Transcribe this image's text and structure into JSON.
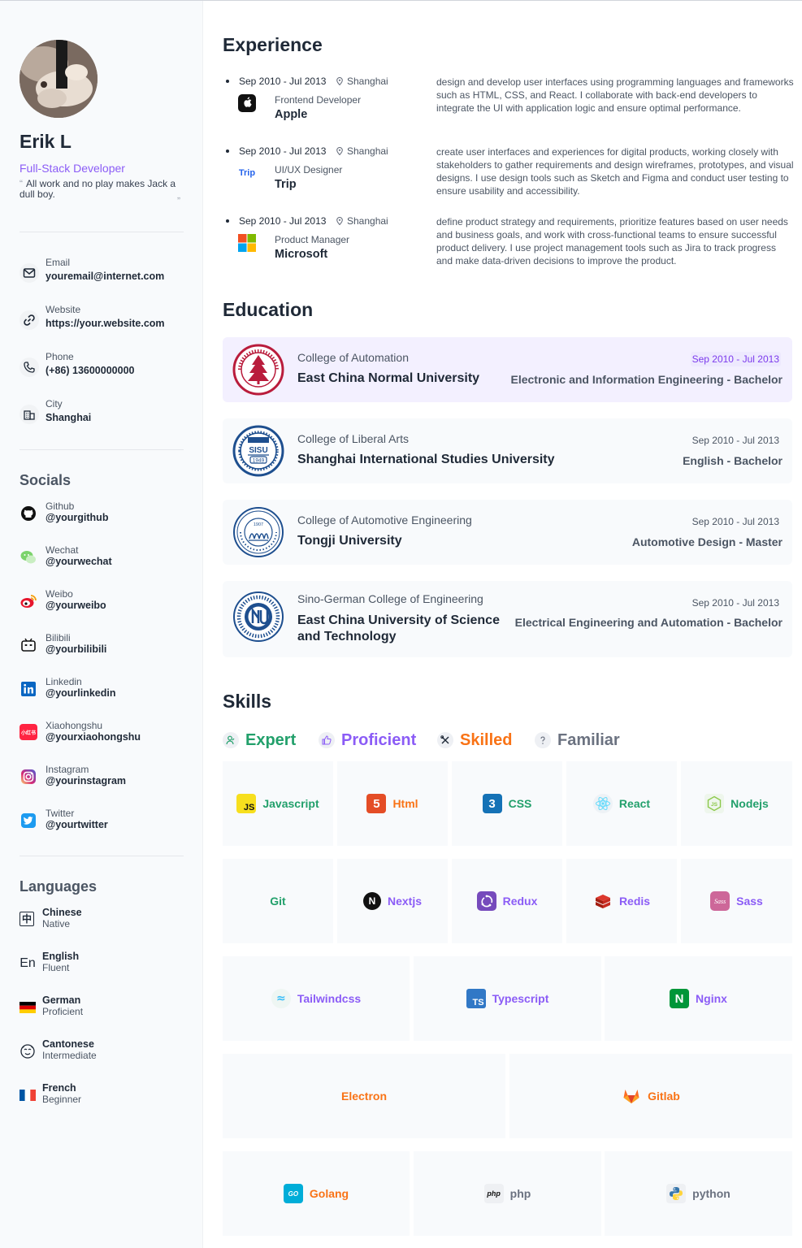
{
  "profile": {
    "name": "Erik L",
    "role": "Full-Stack Developer",
    "quote": "All work and no play makes Jack a dull boy."
  },
  "contacts": [
    {
      "label": "Email",
      "value": "youremail@internet.com",
      "icon": "mail-icon"
    },
    {
      "label": "Website",
      "value": "https://your.website.com",
      "icon": "link-icon"
    },
    {
      "label": "Phone",
      "value": "(+86) 13600000000",
      "icon": "phone-icon"
    },
    {
      "label": "City",
      "value": "Shanghai",
      "icon": "city-icon"
    }
  ],
  "socials": {
    "title": "Socials",
    "items": [
      {
        "label": "Github",
        "value": "@yourgithub",
        "icon": "github-icon"
      },
      {
        "label": "Wechat",
        "value": "@yourwechat",
        "icon": "wechat-icon"
      },
      {
        "label": "Weibo",
        "value": "@yourweibo",
        "icon": "weibo-icon"
      },
      {
        "label": "Bilibili",
        "value": "@yourbilibili",
        "icon": "bilibili-icon"
      },
      {
        "label": "Linkedin",
        "value": "@yourlinkedin",
        "icon": "linkedin-icon"
      },
      {
        "label": "Xiaohongshu",
        "value": "@yourxiaohongshu",
        "icon": "xiaohongshu-icon",
        "glyph": "小红书"
      },
      {
        "label": "Instagram",
        "value": "@yourinstagram",
        "icon": "instagram-icon"
      },
      {
        "label": "Twitter",
        "value": "@yourtwitter",
        "icon": "twitter-icon"
      }
    ]
  },
  "languages": {
    "title": "Languages",
    "items": [
      {
        "label": "Chinese",
        "value": "Native",
        "icon": "chinese-char-icon",
        "glyph": "中"
      },
      {
        "label": "English",
        "value": "Fluent",
        "icon": "english-icon",
        "glyph": "En"
      },
      {
        "label": "German",
        "value": "Proficient",
        "icon": "german-flag-icon"
      },
      {
        "label": "Cantonese",
        "value": "Intermediate",
        "icon": "cantonese-icon"
      },
      {
        "label": "French",
        "value": "Beginner",
        "icon": "french-flag-icon"
      }
    ]
  },
  "experience": {
    "title": "Experience",
    "items": [
      {
        "date": "Sep 2010 - Jul 2013",
        "location": "Shanghai",
        "title": "Frontend Developer",
        "company": "Apple",
        "logo": "apple-logo-icon",
        "desc": "design and develop user interfaces using programming languages and frameworks such as HTML, CSS, and React. I collaborate with back-end developers to integrate the UI with application logic and ensure optimal performance."
      },
      {
        "date": "Sep 2010 - Jul 2013",
        "location": "Shanghai",
        "title": "UI/UX Designer",
        "company": "Trip",
        "logo": "trip-logo-icon",
        "logo_text": "Trip",
        "desc": "create user interfaces and experiences for digital products, working closely with stakeholders to gather requirements and design wireframes, prototypes, and visual designs. I use design tools such as Sketch and Figma and conduct user testing to ensure usability and accessibility."
      },
      {
        "date": "Sep 2010 - Jul 2013",
        "location": "Shanghai",
        "title": "Product Manager",
        "company": "Microsoft",
        "logo": "microsoft-logo-icon",
        "desc": "define product strategy and requirements, prioritize features based on user needs and business goals, and work with cross-functional teams to ensure successful product delivery. I use project management tools such as Jira to track progress and make data-driven decisions to improve the product."
      }
    ]
  },
  "education": {
    "title": "Education",
    "items": [
      {
        "college": "College of Automation",
        "university": "East China Normal University",
        "date": "Sep 2010 - Jul 2013",
        "major": "Electronic and Information Engineering - Bachelor",
        "seal": "ecnu-seal-icon",
        "color": "#b91c3c"
      },
      {
        "college": "College of Liberal Arts",
        "university": "Shanghai International Studies University",
        "date": "Sep 2010 - Jul 2013",
        "major": "English - Bachelor",
        "seal": "sisu-seal-icon",
        "color": "#1e4f8f",
        "seal_text": "SISU",
        "seal_year": "1949"
      },
      {
        "college": "College of Automotive Engineering",
        "university": "Tongji University",
        "date": "Sep 2010 - Jul 2013",
        "major": "Automotive Design - Master",
        "seal": "tongji-seal-icon",
        "color": "#1e4f8f",
        "seal_year": "1907"
      },
      {
        "college": "Sino-German College of Engineering",
        "university": "East China University of Science and Technology",
        "date": "Sep 2010 - Jul 2013",
        "major": "Electrical Engineering and Automation - Bachelor",
        "seal": "ecust-seal-icon",
        "color": "#1e4f8f"
      }
    ]
  },
  "skills": {
    "title": "Skills",
    "levels": [
      {
        "label": "Expert",
        "icon": "expert-icon",
        "color": "#22a06b"
      },
      {
        "label": "Proficient",
        "icon": "thumbs-up-icon",
        "color": "#8b5cf6"
      },
      {
        "label": "Skilled",
        "icon": "tools-icon",
        "color": "#f97316"
      },
      {
        "label": "Familiar",
        "icon": "question-icon",
        "color": "#6b7280"
      }
    ],
    "items": [
      {
        "name": "Javascript",
        "level": "Expert",
        "icon": "javascript-icon",
        "glyph": "JS"
      },
      {
        "name": "Html",
        "level": "Skilled",
        "icon": "html5-icon",
        "glyph": "5"
      },
      {
        "name": "CSS",
        "level": "Expert",
        "icon": "css3-icon",
        "glyph": "3"
      },
      {
        "name": "React",
        "level": "Expert",
        "icon": "react-icon"
      },
      {
        "name": "Nodejs",
        "level": "Expert",
        "icon": "nodejs-icon",
        "glyph": "JS"
      },
      {
        "name": "Git",
        "level": "Expert",
        "icon": "git-icon"
      },
      {
        "name": "Nextjs",
        "level": "Proficient",
        "icon": "nextjs-icon",
        "glyph": "N"
      },
      {
        "name": "Redux",
        "level": "Proficient",
        "icon": "redux-icon"
      },
      {
        "name": "Redis",
        "level": "Proficient",
        "icon": "redis-icon"
      },
      {
        "name": "Sass",
        "level": "Proficient",
        "icon": "sass-icon",
        "glyph": "Sass"
      },
      {
        "name": "Tailwindcss",
        "level": "Proficient",
        "icon": "tailwind-icon",
        "glyph": "≈"
      },
      {
        "name": "Typescript",
        "level": "Proficient",
        "icon": "typescript-icon",
        "glyph": "TS"
      },
      {
        "name": "Nginx",
        "level": "Proficient",
        "icon": "nginx-icon",
        "glyph": "N"
      },
      {
        "name": "Electron",
        "level": "Skilled",
        "icon": "electron-icon"
      },
      {
        "name": "Gitlab",
        "level": "Skilled",
        "icon": "gitlab-icon"
      },
      {
        "name": "Golang",
        "level": "Skilled",
        "icon": "golang-icon",
        "glyph": "GO"
      },
      {
        "name": "php",
        "level": "Familiar",
        "icon": "php-icon",
        "glyph": "php"
      },
      {
        "name": "python",
        "level": "Familiar",
        "icon": "python-icon"
      }
    ]
  }
}
